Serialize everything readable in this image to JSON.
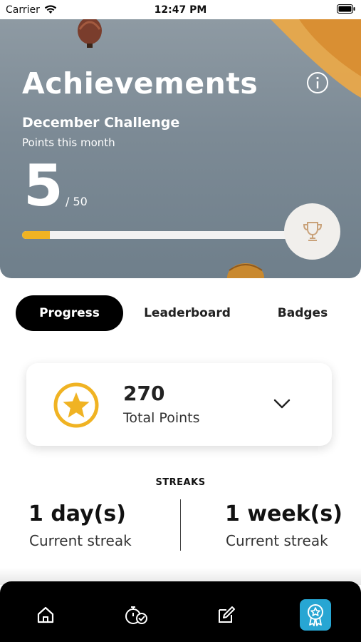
{
  "status_bar": {
    "carrier": "Carrier",
    "time": "12:47 PM"
  },
  "hero": {
    "title": "Achievements",
    "challenge_name": "December Challenge",
    "points_label": "Points this month",
    "points_value": "5",
    "points_max": "/ 50",
    "progress_fraction": 0.1
  },
  "tabs": [
    {
      "label": "Progress",
      "active": true
    },
    {
      "label": "Leaderboard",
      "active": false
    },
    {
      "label": "Badges",
      "active": false
    }
  ],
  "points_card": {
    "total": "270",
    "label": "Total Points",
    "icon": "star-icon"
  },
  "streaks": {
    "title": "STREAKS",
    "items": [
      {
        "value": "1 day(s)",
        "label": "Current streak"
      },
      {
        "value": "1 week(s)",
        "label": "Current streak"
      }
    ]
  },
  "bottom_nav": [
    {
      "icon": "home-icon"
    },
    {
      "icon": "stopwatch-check-icon"
    },
    {
      "icon": "edit-icon"
    },
    {
      "icon": "award-ribbon-icon",
      "active": true
    }
  ],
  "colors": {
    "accent": "#f0b323",
    "active_nav": "#27a6d3",
    "hero_bg": "#7c8a95",
    "tab_active_bg": "#000000"
  }
}
